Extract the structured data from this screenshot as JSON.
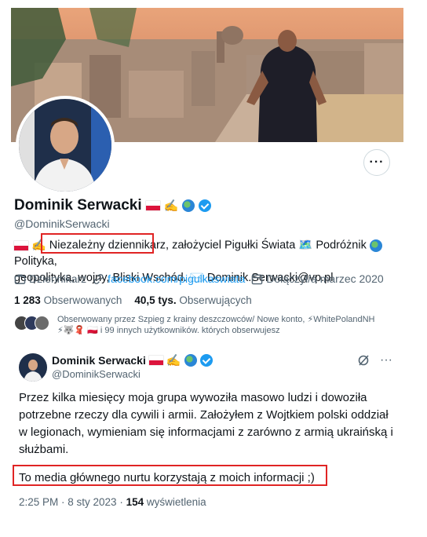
{
  "profile": {
    "display_name": "Dominik Serwacki",
    "handle": "@DominikSerwacki",
    "bio_line1_highlight": "Niezależny dziennikarz,",
    "bio_line1_rest": " założyciel Pigułki Świata 🗺️ Podróżnik",
    "bio_line1_end": " Polityka,",
    "bio_line2": "geopolityka, wojny, Bliski Wschód. ✉️ Dominik.Serwacki@vp.pl",
    "meta": {
      "job": "Dziennikarz",
      "link": "facebook.com/pigulkaswiata",
      "joined": "Dołączył/a marzec 2020"
    },
    "following_count": "1 283",
    "following_label": "Obserwowanych",
    "followers_count": "40,5 tys.",
    "followers_label": "Obserwujących",
    "followed_by_line1": "Obserwowany przez Szpieg z krainy deszczowców/ Nowe konto, ⚡WhitePolandNH",
    "followed_by_line2": "⚡🐺🧣 🇵🇱 i 99 innych użytkowników. których obserwujesz",
    "more_label": "···"
  },
  "tweet": {
    "display_name": "Dominik Serwacki",
    "handle": "@DominikSerwacki",
    "paragraph1": "Przez kilka miesięcy moja grupa wywoziła masowo ludzi i dowoziła potrzebne rzeczy dla cywili i armii. Założyłem z Wojtkiem polski oddział w legionach, wymieniam się informacjami z zarówno z armią ukraińską i służbami.",
    "paragraph2": "To media głównego nurtu korzystają z moich informacji ;)",
    "timestamp": "2:25 PM · 8 sty 2023 ·",
    "views_count": "154",
    "views_label": "wyświetlenia",
    "more_label": "···"
  },
  "colors": {
    "accent": "#1d9bf0",
    "highlight": "#e02424",
    "text_secondary": "#536471"
  }
}
